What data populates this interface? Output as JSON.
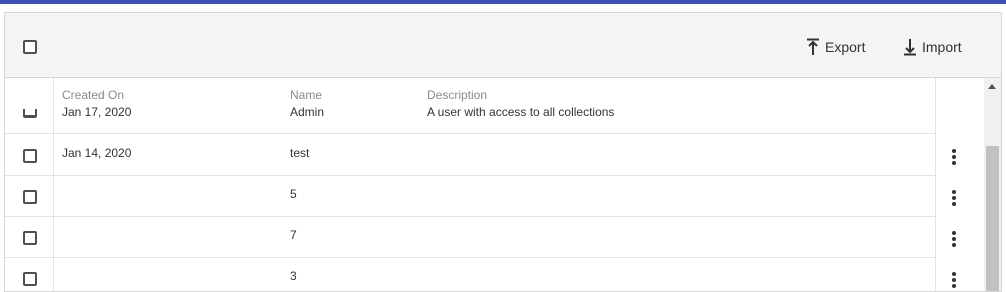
{
  "toolbar": {
    "export_label": "Export",
    "import_label": "Import",
    "export_icon": "export-icon",
    "import_icon": "import-icon"
  },
  "table": {
    "columns": [
      "Created On",
      "Name",
      "Description"
    ],
    "rows": [
      {
        "created_on": "Jan 17, 2020",
        "name": "Admin",
        "description": "A user with access to all collections"
      },
      {
        "created_on": "Jan 14, 2020",
        "name": "test",
        "description": ""
      },
      {
        "created_on": "",
        "name": "5",
        "description": ""
      },
      {
        "created_on": "",
        "name": "7",
        "description": ""
      },
      {
        "created_on": "",
        "name": "3",
        "description": ""
      }
    ]
  },
  "colors": {
    "accent": "#3f51b5",
    "toolbar_bg": "#f4f4f4",
    "border": "#d6d6d6"
  }
}
